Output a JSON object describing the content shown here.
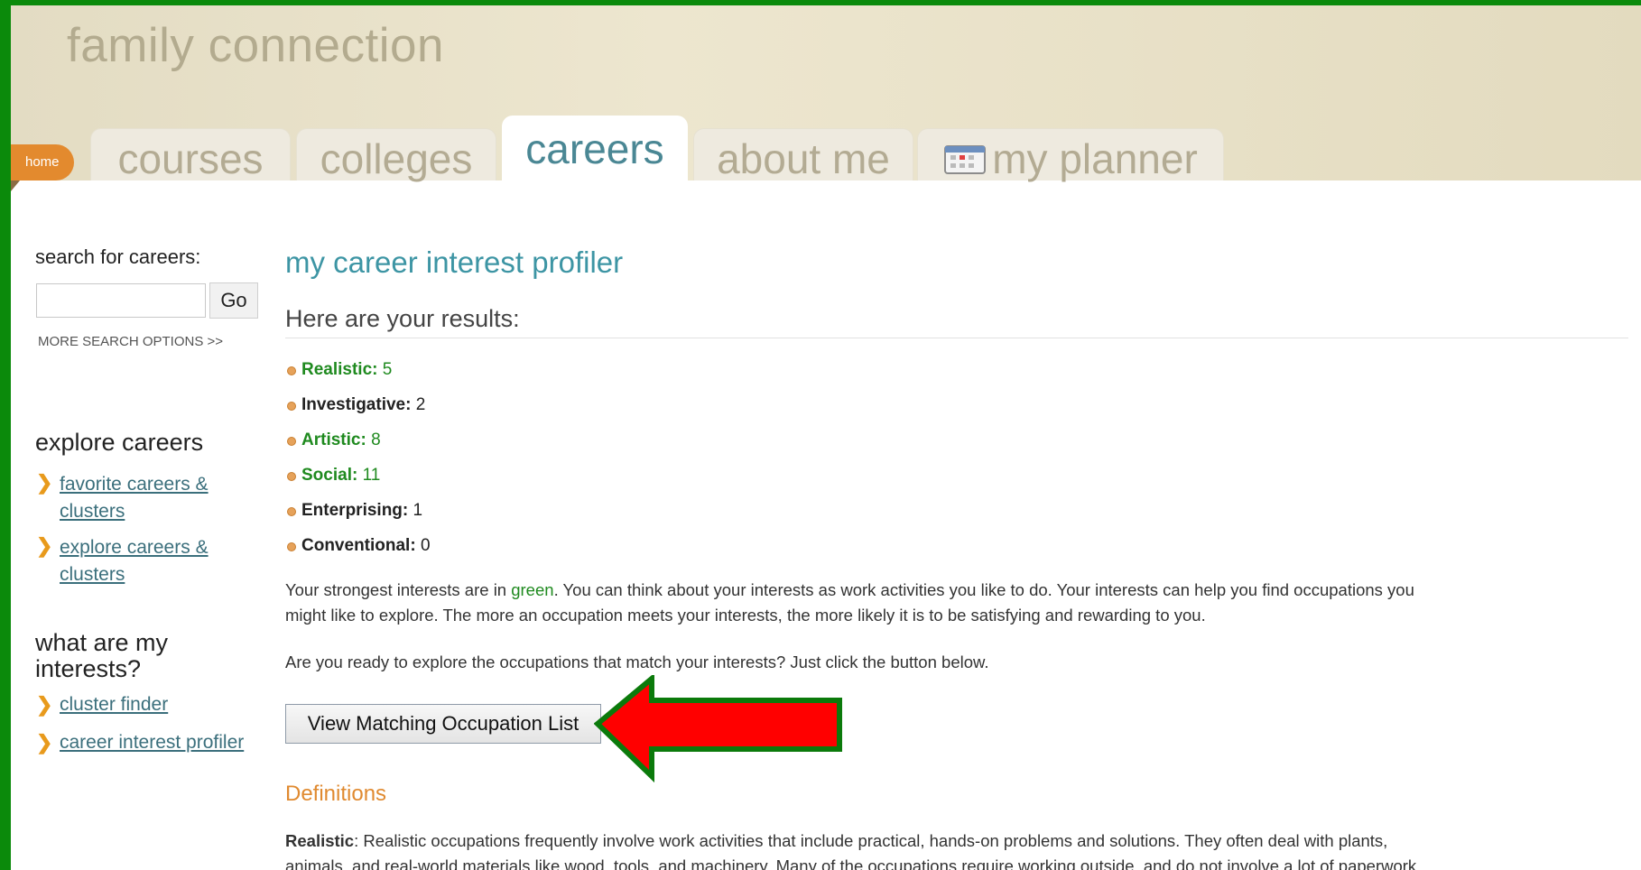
{
  "header": {
    "brand": "family connection",
    "home_label": "home",
    "tabs": [
      {
        "label": "courses"
      },
      {
        "label": "colleges"
      },
      {
        "label": "careers"
      },
      {
        "label": "about me"
      },
      {
        "label": "my planner"
      }
    ]
  },
  "sidebar": {
    "search_label": "search for careers:",
    "search_value": "",
    "go_label": "Go",
    "more_search": "MORE SEARCH OPTIONS >>",
    "explore_heading": "explore careers",
    "explore_links": [
      {
        "label_line1": "favorite careers &",
        "label_line2": "clusters"
      },
      {
        "label_line1": "explore careers &",
        "label_line2": "clusters"
      }
    ],
    "interests_heading_line1": "what are my",
    "interests_heading_line2": "interests?",
    "interest_links": [
      {
        "label": "cluster finder"
      },
      {
        "label": "career interest profiler"
      }
    ]
  },
  "main": {
    "title": "my career interest profiler",
    "results_heading": "Here are your results:",
    "scores": [
      {
        "name": "Realistic:",
        "value": "5",
        "strong": true
      },
      {
        "name": "Investigative:",
        "value": "2",
        "strong": false
      },
      {
        "name": "Artistic:",
        "value": "8",
        "strong": true
      },
      {
        "name": "Social:",
        "value": "11",
        "strong": true
      },
      {
        "name": "Enterprising:",
        "value": "1",
        "strong": false
      },
      {
        "name": "Conventional:",
        "value": "0",
        "strong": false
      }
    ],
    "para1_before": "Your strongest interests are in ",
    "para1_green": "green",
    "para1_after": ". You can think about your interests as work activities you like to do. Your interests can help you find occupations you",
    "para1_line2": "might like to explore. The more an occupation meets your interests, the more likely it is to be satisfying and rewarding to you.",
    "para2": "Are you ready to explore the occupations that match your interests? Just click the button below.",
    "view_button": "View Matching Occupation List",
    "definitions_heading": "Definitions",
    "def_term": "Realistic",
    "def_line1": ": Realistic occupations frequently involve work activities that include practical, hands-on problems and solutions. They often deal with plants,",
    "def_line2": "animals, and real-world materials like wood, tools, and machinery. Many of the occupations require working outside, and do not involve a lot of paperwork"
  },
  "colors": {
    "page_border": "#0b8a0b",
    "accent_teal": "#3d95a4",
    "strong_green": "#1f8a1f",
    "home_orange": "#e38a2e",
    "arrow_red": "#ff0000",
    "arrow_outline": "#0b7a0b"
  }
}
